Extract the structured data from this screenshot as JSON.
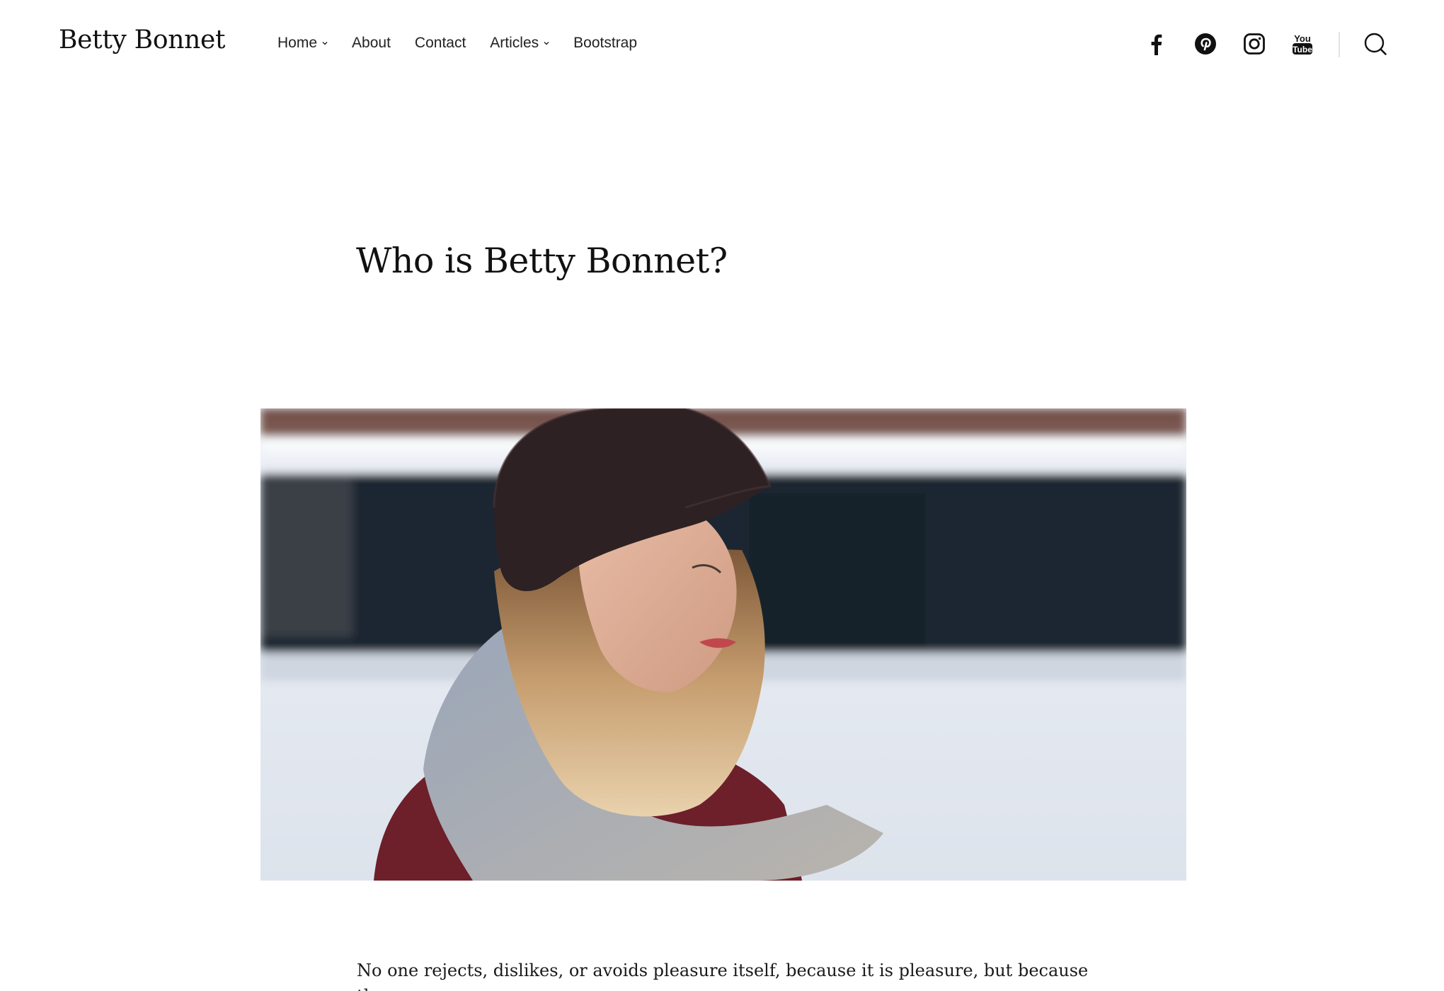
{
  "site": {
    "title": "Betty Bonnet"
  },
  "nav": {
    "items": [
      {
        "label": "Home",
        "has_submenu": true
      },
      {
        "label": "About",
        "has_submenu": false
      },
      {
        "label": "Contact",
        "has_submenu": false
      },
      {
        "label": "Articles",
        "has_submenu": true
      },
      {
        "label": "Bootstrap",
        "has_submenu": false
      }
    ]
  },
  "social": {
    "icons": [
      "facebook-icon",
      "pinterest-icon",
      "instagram-icon",
      "youtube-icon"
    ],
    "youtube_label_top": "You",
    "youtube_label_bottom": "Tube"
  },
  "search": {
    "icon": "search-icon"
  },
  "post": {
    "title": "Who is Betty Bonnet?",
    "image_alt": "Woman in a dark knit beanie and grey scarf in the snow",
    "body_first_line": "No one rejects, dislikes, or avoids pleasure itself, because it is pleasure, but because those"
  },
  "colors": {
    "text": "#111111",
    "background": "#ffffff",
    "divider": "#e2e2e2"
  }
}
